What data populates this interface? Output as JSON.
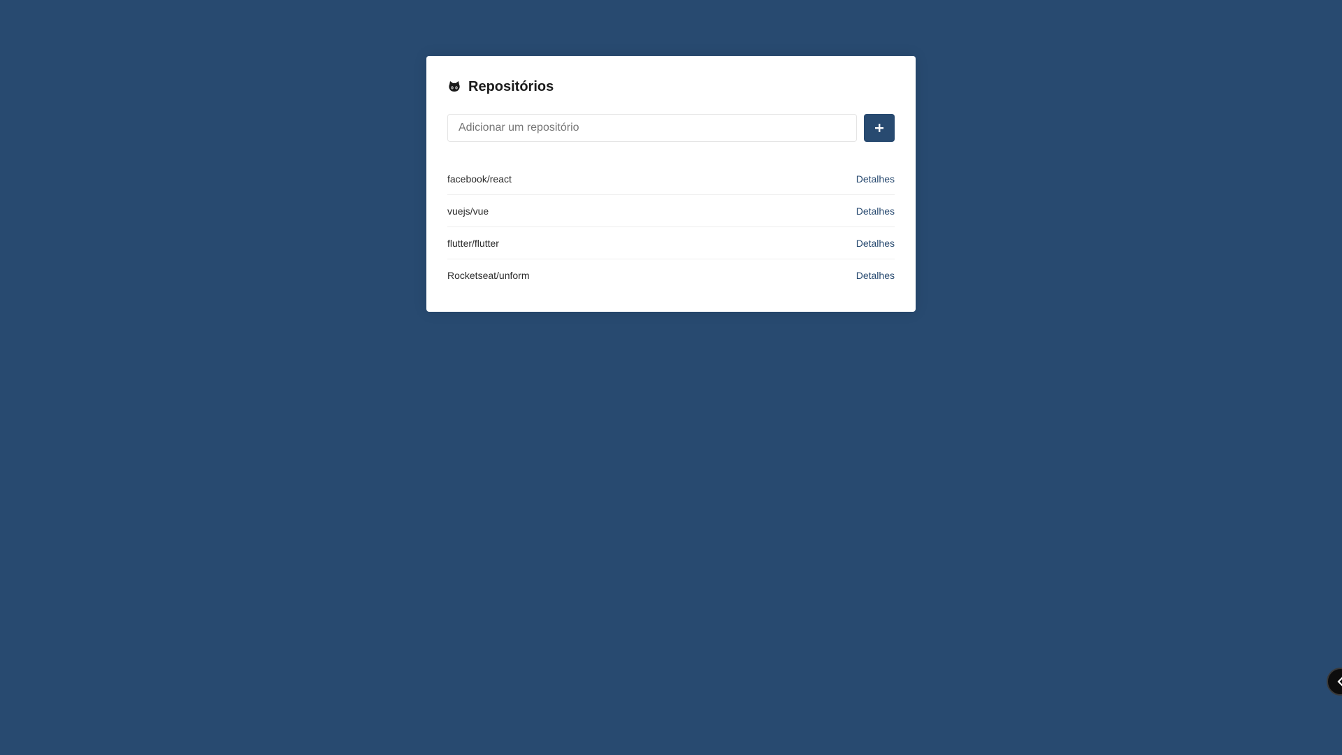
{
  "header": {
    "icon": "github-icon",
    "title": "Repositórios"
  },
  "form": {
    "placeholder": "Adicionar um repositório",
    "value": "",
    "submit_icon": "plus-icon"
  },
  "repositories": [
    {
      "name": "facebook/react",
      "link": "Detalhes"
    },
    {
      "name": "vuejs/vue",
      "link": "Detalhes"
    },
    {
      "name": "flutter/flutter",
      "link": "Detalhes"
    },
    {
      "name": "Rocketseat/unform",
      "link": "Detalhes"
    }
  ],
  "floating_toggle": {
    "icon": "chevron-left-icon"
  },
  "colors": {
    "background": "#284a70",
    "card": "#ffffff",
    "accent": "#284a70"
  }
}
